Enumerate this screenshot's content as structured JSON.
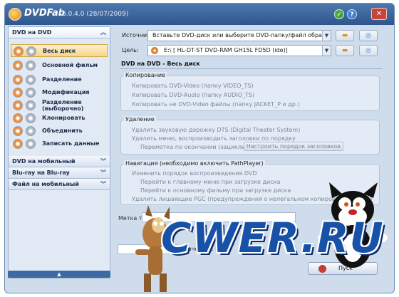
{
  "app": {
    "name": "DVDFab",
    "version": "6.0.4.0 (28/07/2009)"
  },
  "titlebar": {
    "ok_icon": "check-icon",
    "help_icon": "question-icon",
    "close_icon": "close-icon"
  },
  "sidebar": {
    "categories": [
      {
        "label": "DVD на DVD",
        "expanded": true
      },
      {
        "label": "DVD на мобильный",
        "expanded": false
      },
      {
        "label": "Blu-ray на Blu-ray",
        "expanded": false
      },
      {
        "label": "Файл на мобильный",
        "expanded": false
      }
    ],
    "modes": [
      {
        "label": "Весь диск",
        "selected": true
      },
      {
        "label": "Основной фильм",
        "selected": false
      },
      {
        "label": "Разделение",
        "selected": false
      },
      {
        "label": "Модификация",
        "selected": false
      },
      {
        "label": "Разделение (выборочно)",
        "selected": false
      },
      {
        "label": "Клонировать",
        "selected": false
      },
      {
        "label": "Объединить",
        "selected": false
      },
      {
        "label": "Записать данные",
        "selected": false
      }
    ],
    "collapse_glyph": "▲",
    "chevron_up": "︽",
    "chevron_down": "︾"
  },
  "source": {
    "label": "Источник:",
    "value": "Вставьте DVD-диск или выберите DVD-папку/файл образа"
  },
  "target": {
    "label": "Цель:",
    "value": "E:\\ [ HL-DT-ST DVD-RAM GH15L FD5D (ide)]"
  },
  "section_title": "DVD на DVD - Весь диск",
  "copy_group": {
    "title": "Копирование",
    "options": [
      "Копировать DVD-Video (папку VIDEO_TS)",
      "Копировать DVD-Audio (папку AUDIO_TS)",
      "Копировать не DVD-Video файлы (папку JACKET_P и др.)"
    ]
  },
  "remove_group": {
    "title": "Удаление",
    "options": [
      "Удалить звуковую дорожку DTS (Digital Theater System)",
      "Удалить меню, воспроизводить заголовки по порядку",
      "Перемотка по окончании (зациклить)"
    ],
    "button": "Настроить порядок заголовков"
  },
  "nav_group": {
    "title": "Навигация (необходимо включить PathPlayer)",
    "options": [
      "Изменить порядок воспроизведения DVD",
      "Перейти к главному меню при загрузке диска",
      "Перейти к основному фильму при загрузке диска",
      "Удалить лишающие PGC (предупреждения о нелегальном копировании и т. д.)"
    ]
  },
  "volume_label": "Метка тома:",
  "quality_label": "Качество: N/A",
  "start_button": "Пуск",
  "watermark": "CWER.RU"
}
